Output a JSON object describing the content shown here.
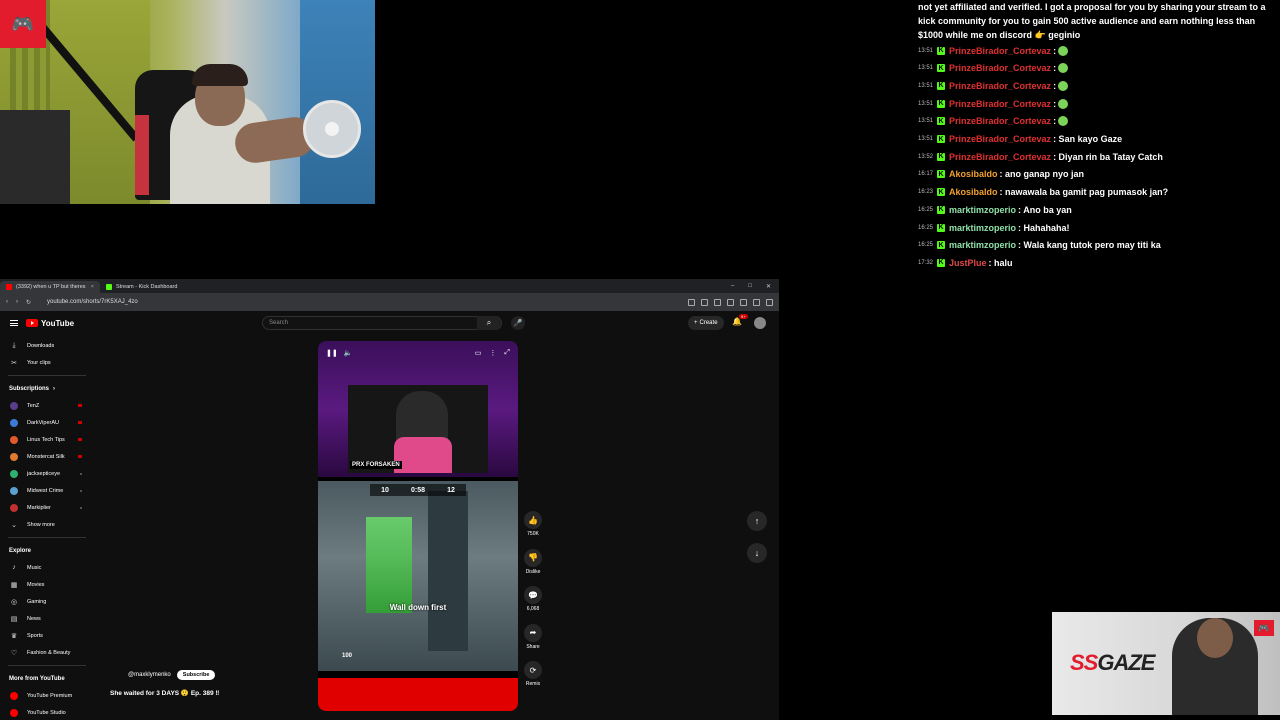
{
  "stream_logo": "🎮",
  "chat": {
    "intro": "not yet affiliated and verified. I got a proposal for you by sharing your stream to a kick community for you to gain 500 active audience and earn nothing less than $1000 while me on discord 👉 geginio",
    "messages": [
      {
        "time": "13:51",
        "user": "PrinzeBirador_Cortevaz",
        "text": ":",
        "color": "#e03030",
        "emote": true
      },
      {
        "time": "13:51",
        "user": "PrinzeBirador_Cortevaz",
        "text": ":",
        "color": "#e03030",
        "emote": true
      },
      {
        "time": "13:51",
        "user": "PrinzeBirador_Cortevaz",
        "text": ":",
        "color": "#e03030",
        "emote": true
      },
      {
        "time": "13:51",
        "user": "PrinzeBirador_Cortevaz",
        "text": ":",
        "color": "#e03030",
        "emote": true
      },
      {
        "time": "13:51",
        "user": "PrinzeBirador_Cortevaz",
        "text": ":",
        "color": "#e03030",
        "emote": true
      },
      {
        "time": "13:51",
        "user": "PrinzeBirador_Cortevaz",
        "text": ": San kayo Gaze",
        "color": "#e03030",
        "emote": false
      },
      {
        "time": "13:52",
        "user": "PrinzeBirador_Cortevaz",
        "text": ": Diyan rin ba Tatay Catch",
        "color": "#e03030",
        "emote": false
      },
      {
        "time": "16:17",
        "user": "Akosibaldo",
        "text": ": ano ganap nyo jan",
        "color": "#f0a030",
        "emote": false
      },
      {
        "time": "16:23",
        "user": "Akosibaldo",
        "text": ": nawawala ba gamit pag pumasok jan?",
        "color": "#f0a030",
        "emote": false
      },
      {
        "time": "16:25",
        "user": "marktimzoperio",
        "text": ": Ano ba yan",
        "color": "#8fe0a8",
        "emote": false
      },
      {
        "time": "16:25",
        "user": "marktimzoperio",
        "text": ": Hahahaha!",
        "color": "#8fe0a8",
        "emote": false
      },
      {
        "time": "16:25",
        "user": "marktimzoperio",
        "text": ": Wala kang tutok pero may titi ka",
        "color": "#8fe0a8",
        "emote": false
      },
      {
        "time": "17:32",
        "user": "JustPlue",
        "text": ": halu",
        "color": "#e04a4a",
        "emote": false
      }
    ]
  },
  "overlay": {
    "ss": "SS",
    "gaze": "GAZE"
  },
  "browser": {
    "tabs": [
      {
        "label": "(3392) when u TP but theres",
        "color": "#ff0000",
        "active": true
      },
      {
        "label": "Stream - Kick Dashboard",
        "color": "#53fc18",
        "active": false
      }
    ],
    "url": "youtube.com/shorts/7rK5XAJ_4zo"
  },
  "youtube": {
    "logo": "YouTube",
    "search_placeholder": "Search",
    "create": "Create",
    "notif_count": "9+",
    "sidebar": {
      "top": [
        {
          "icon": "⤓",
          "label": "Downloads",
          "name": "downloads"
        },
        {
          "icon": "✂",
          "label": "Your clips",
          "name": "your-clips"
        }
      ],
      "subs_title": "Subscriptions",
      "subs": [
        {
          "label": "TenZ",
          "color": "#5a3d8a",
          "live": true
        },
        {
          "label": "DarkViperAU",
          "color": "#3a7bd5",
          "live": true
        },
        {
          "label": "Linus Tech Tips",
          "color": "#e05a2a",
          "live": true
        },
        {
          "label": "Monstercat Silk",
          "color": "#e07a30",
          "live": true
        },
        {
          "label": "jacksepticeye",
          "color": "#30b070",
          "live": false
        },
        {
          "label": "Midwest Crime",
          "color": "#5aa0d0",
          "live": false
        },
        {
          "label": "Markiplier",
          "color": "#c03030",
          "live": false
        }
      ],
      "show_more": "Show more",
      "explore_title": "Explore",
      "explore": [
        {
          "icon": "♪",
          "label": "Music"
        },
        {
          "icon": "▦",
          "label": "Movies"
        },
        {
          "icon": "◎",
          "label": "Gaming"
        },
        {
          "icon": "▤",
          "label": "News"
        },
        {
          "icon": "♛",
          "label": "Sports"
        },
        {
          "icon": "♡",
          "label": "Fashion & Beauty"
        }
      ],
      "more_title": "More from YouTube",
      "more": [
        {
          "label": "YouTube Premium",
          "color": "#ff0000"
        },
        {
          "label": "YouTube Studio",
          "color": "#ff0000"
        }
      ]
    },
    "short": {
      "cam_name": "PRX FORSAKEN",
      "score_left": "10",
      "timer": "0:58",
      "score_right": "12",
      "caption": "Wall down first",
      "hp": "100",
      "channel": "@maxklymenko",
      "subscribe": "Subscribe",
      "title": "She waited for 3 DAYS 😲 Ep. 389 ‼"
    },
    "actions": [
      {
        "icon": "👍",
        "label": "750K",
        "name": "like"
      },
      {
        "icon": "👎",
        "label": "Dislike",
        "name": "dislike"
      },
      {
        "icon": "💬",
        "label": "6,068",
        "name": "comments"
      },
      {
        "icon": "➦",
        "label": "Share",
        "name": "share"
      },
      {
        "icon": "⟳",
        "label": "Remix",
        "name": "remix"
      }
    ]
  }
}
